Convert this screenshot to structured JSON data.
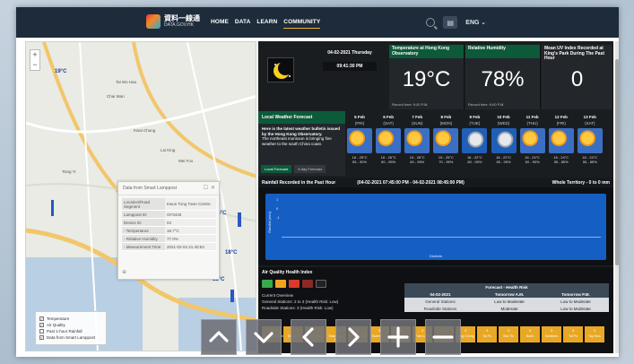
{
  "nav": {
    "brand_zh": "資料一線通",
    "brand_en": "DATA.GOV.HK",
    "items": [
      "HOME",
      "DATA",
      "LEARN",
      "COMMUNITY"
    ],
    "lang": "ENG"
  },
  "map": {
    "zoom_in": "+",
    "zoom_out": "−",
    "temps": [
      "19°C",
      "18°C",
      "18°C",
      "18°C"
    ],
    "place_names": [
      "Tai Wo Hau",
      "Chai Wan",
      "Kwai Chung",
      "Tsing Yi",
      "Mei Foo",
      "Lai King"
    ],
    "popup": {
      "title": "Data from Smart Lamppost",
      "rows": [
        {
          "label": "Location/Road Segment",
          "value": "Kwun Tong Town Centre"
        },
        {
          "label": "Lamppost ID",
          "value": "GF3445"
        },
        {
          "label": "Device ID",
          "value": "04"
        },
        {
          "label": "- Temperature",
          "value": "18.7°C"
        },
        {
          "label": "- Relative Humidity",
          "value": "77.0%"
        },
        {
          "label": "- Measurement Time",
          "value": "2021-02-04 21:40:53"
        }
      ]
    },
    "layers": [
      {
        "label": "Temperature",
        "checked": true
      },
      {
        "label": "Air Quality",
        "checked": true
      },
      {
        "label": "Past 1-hour Rainfall",
        "checked": false
      },
      {
        "label": "Data from Smart Lamppost",
        "checked": true
      }
    ]
  },
  "dash": {
    "date": "04-02-2021 Thursday",
    "time": "09:41:30 PM",
    "kpis": [
      {
        "title": "Temperature at Hong Kong Observatory",
        "value": "19°C",
        "foot": "Record time: 9:00 P.M."
      },
      {
        "title": "Relative Humidity",
        "value": "78%",
        "foot": "Record time: 9:00 P.M."
      },
      {
        "title": "Mean UV Index Recorded at King's Park During The Past Hour",
        "value": "0",
        "foot": ""
      }
    ],
    "lwf": {
      "title": "Local Weather Forecast",
      "bold": "Here is the latest weather bulletin issued by the Hong Kong Observatory.",
      "text": "The northeast monsoon is bringing fine weather to the south China coast.",
      "tab1": "Local Forecast",
      "tab2": "9-day Forecast"
    },
    "forecast": [
      {
        "date": "5 Feb",
        "wd": "(FRI)",
        "icon": "sun",
        "range": "18 - 25°C",
        "hum": "55 - 90%"
      },
      {
        "date": "6 Feb",
        "wd": "(SAT)",
        "icon": "sun",
        "range": "18 - 26°C",
        "hum": "60 - 95%"
      },
      {
        "date": "7 Feb",
        "wd": "(SUN)",
        "icon": "sun",
        "range": "19 - 26°C",
        "hum": "60 - 95%"
      },
      {
        "date": "8 Feb",
        "wd": "(MON)",
        "icon": "sun",
        "range": "19 - 25°C",
        "hum": "70 - 95%"
      },
      {
        "date": "9 Feb",
        "wd": "(TUE)",
        "icon": "cloud",
        "range": "18 - 22°C",
        "hum": "80 - 95%"
      },
      {
        "date": "10 Feb",
        "wd": "(WED)",
        "icon": "cloud",
        "range": "18 - 22°C",
        "hum": "80 - 95%"
      },
      {
        "date": "11 Feb",
        "wd": "(THU)",
        "icon": "sun",
        "range": "18 - 24°C",
        "hum": "60 - 90%"
      },
      {
        "date": "12 Feb",
        "wd": "(FRI)",
        "icon": "sun",
        "range": "18 - 24°C",
        "hum": "55 - 85%"
      },
      {
        "date": "13 Feb",
        "wd": "(SAT)",
        "icon": "sun",
        "range": "18 - 24°C",
        "hum": "55 - 85%"
      }
    ],
    "rain": {
      "title": "Rainfall Recorded in the Past Hour",
      "period": "(04-02-2021 07:45:00 PM - 04-02-2021 08:45:00 PM)",
      "territory": "Whole Territory - 0 to 0 mm",
      "ylabel": "Rainfall (mm)",
      "xlabel": "Districts",
      "ticks": [
        "1",
        "0",
        "-1"
      ]
    },
    "aqhi": {
      "title": "Air Quality Health Index",
      "overview": "Current Overview",
      "general": "General Stations: 2 to 3 (Health Risk: Low)",
      "roadside": "Roadside Stations: 3 (Health Risk: Low)",
      "table_title": "Forecast - Health Risk",
      "date": "04-02-2021",
      "am": "Tomorrow A.M.",
      "pm": "Tomorrow P.M.",
      "rows": [
        {
          "label": "General Stations",
          "am": "Low to Moderate",
          "pm": "Low to Moderate"
        },
        {
          "label": "Roadside Stations",
          "am": "Moderate",
          "pm": "Low to Moderate"
        }
      ],
      "stations": [
        {
          "n": "3",
          "name": "Central/Western"
        },
        {
          "n": "3",
          "name": "Eastern"
        },
        {
          "n": "3",
          "name": "Kwun Tong"
        },
        {
          "n": "3",
          "name": "Sham Shui Po"
        },
        {
          "n": "3",
          "name": "Kwai Chung"
        },
        {
          "n": "3",
          "name": "Tsuen Wan"
        },
        {
          "n": "3",
          "name": "Tseung Kwan O"
        },
        {
          "n": "3",
          "name": "Yuen Long"
        },
        {
          "n": "3",
          "name": "Tuen Mun"
        },
        {
          "n": "3",
          "name": "Tung Chung"
        },
        {
          "n": "3",
          "name": "Tai Po"
        },
        {
          "n": "3",
          "name": "Sha Tin"
        },
        {
          "n": "3",
          "name": "North"
        },
        {
          "n": "3",
          "name": "Southern"
        },
        {
          "n": "3",
          "name": "Tai Po"
        },
        {
          "n": "3",
          "name": "Tap Mun"
        },
        {
          "n": "3",
          "name": "Tseung Kwan O"
        },
        {
          "n": "3",
          "name": "Tuen Mun"
        }
      ]
    }
  },
  "colors": {
    "nav_bg": "#1d2b3a",
    "panel_green": "#0c5a3a",
    "rain_blue": "#155fc4",
    "aqhi_orange": "#e8a825"
  }
}
